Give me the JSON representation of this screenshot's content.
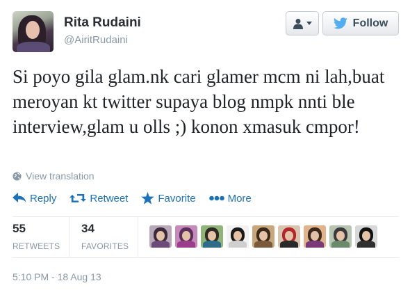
{
  "author": {
    "name": "Rita Rudaini",
    "handle": "@AiritRudaini"
  },
  "buttons": {
    "user_actions_icon": "person-dropdown-icon",
    "follow_label": "Follow"
  },
  "tweet": {
    "text": "Si poyo gila glam.nk cari glamer mcm ni lah,buat meroyan kt twitter supaya blog nmpk nnti ble interview,glam u olls ;) konon xmasuk cmpor!",
    "translate_label": "View translation",
    "timestamp": "5:10 PM - 18 Aug 13"
  },
  "actions": {
    "reply": "Reply",
    "retweet": "Retweet",
    "favorite": "Favorite",
    "more": "More"
  },
  "stats": {
    "retweets_count": "55",
    "retweets_label": "RETWEETS",
    "favorites_count": "34",
    "favorites_label": "FAVORITES"
  },
  "colors": {
    "link_blue": "#1d72b8",
    "muted_gray": "#8899a6",
    "twitter_bird": "#55acee"
  },
  "favoriter_avatars": [
    {
      "hair": "#3b2a3a",
      "body": "#6c4a7a",
      "bg": "#b9a8b8"
    },
    {
      "hair": "#5a2f5c",
      "body": "#9a3d8c",
      "bg": "#c48ab8"
    },
    {
      "hair": "#2e2a20",
      "body": "#2f6b8a",
      "bg": "#8fb37a"
    },
    {
      "hair": "#1a1a1a",
      "body": "#cfcfcf",
      "bg": "#f2f2f2"
    },
    {
      "hair": "#3a2a1c",
      "body": "#7a5a3a",
      "bg": "#c9a77c"
    },
    {
      "hair": "#b3262a",
      "body": "#2a2a2a",
      "bg": "#d9c4b0"
    },
    {
      "hair": "#3c2a1e",
      "body": "#7a3a7a",
      "bg": "#e0b38a"
    },
    {
      "hair": "#3a3a3a",
      "body": "#6b8a6a",
      "bg": "#b8c4b2"
    },
    {
      "hair": "#111111",
      "body": "#303030",
      "bg": "#d8d8d8"
    }
  ]
}
